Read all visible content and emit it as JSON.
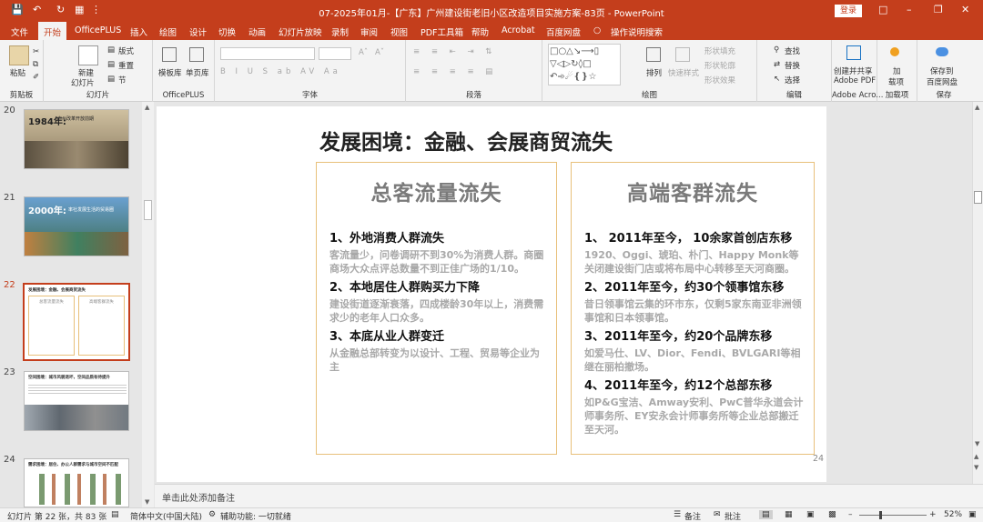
{
  "titlebar": {
    "title": "07-2025年01月-【广东】广州建设街老旧小区改造项目实施方案-83页  -  PowerPoint",
    "login": "登录"
  },
  "menu": {
    "tabs": [
      "文件",
      "开始",
      "OfficePLUS",
      "插入",
      "绘图",
      "设计",
      "切换",
      "动画",
      "幻灯片放映",
      "录制",
      "审阅",
      "视图",
      "PDF工具箱",
      "帮助",
      "Acrobat",
      "百度网盘"
    ],
    "active": "开始",
    "search": "操作说明搜索",
    "share": "共享"
  },
  "ribbon": {
    "clipboard": {
      "paste": "粘贴",
      "label": "剪贴板"
    },
    "slides": {
      "new_slide": "新建",
      "new_slide2": "幻灯片",
      "layout": "版式",
      "reset": "重置",
      "section": "节",
      "label": "幻灯片"
    },
    "officeplus": {
      "templates": "模板库",
      "single": "单页库",
      "label": "OfficePLUS"
    },
    "font": {
      "label": "字体"
    },
    "paragraph": {
      "label": "段落"
    },
    "drawing": {
      "arrange": "排列",
      "quick_style": "快速样式",
      "fill": "形状填充",
      "outline": "形状轮廓",
      "effect": "形状效果",
      "label": "绘图"
    },
    "editing": {
      "find": "查找",
      "replace": "替换",
      "select": "选择",
      "label": "编辑"
    },
    "adobe": {
      "create1": "创建并共享",
      "create2": "Adobe PDF",
      "label": "Adobe Acro..."
    },
    "addins": {
      "addin1": "加",
      "addin2": "载项",
      "label": "加载项"
    },
    "save": {
      "save1": "保存到",
      "save2": "百度网盘",
      "label": "保存"
    }
  },
  "thumbnails": [
    {
      "num": "20",
      "year": "1984年:",
      "caption": "广州改革开放前期"
    },
    {
      "num": "21",
      "year": "2000年:",
      "caption": "率社发展生活的贸易圈"
    },
    {
      "num": "22",
      "caption": "发展困境：金融、会展商贸流失",
      "left": "总客流量流失",
      "right": "高端客群流失"
    },
    {
      "num": "23",
      "caption": "空间困境：城市风貌退坏，空间品质有待提升"
    },
    {
      "num": "24",
      "caption": "需求困境：居住、办公人群需求与城市空间不匹配"
    }
  ],
  "slide": {
    "title": "发展困境：金融、会展商贸流失",
    "left": {
      "title": "总客流量流失",
      "items": [
        {
          "head": "1、外地消费人群流失",
          "body": "客流量少，问卷调研不到30%为消费人群。商圈商场大众点评总数量不到正佳广场的1/10。"
        },
        {
          "head": "2、本地居住人群购买力下降",
          "body": "建设街道逐渐衰落，四成楼龄30年以上，消费需求少的老年人口众多。"
        },
        {
          "head": "3、本底从业人群变迁",
          "body": "从金融总部转变为以设计、工程、贸易等企业为主"
        }
      ]
    },
    "right": {
      "title": "高端客群流失",
      "items": [
        {
          "head": "1、 2011年至今， 10余家首创店东移",
          "body": "1920、Oggi、琥珀、朴门、Happy Monk等关闭建设街门店或将布局中心转移至天河商圈。"
        },
        {
          "head": "2、2011年至今，约30个领事馆东移",
          "body": "昔日领事馆云集的环市东，仅剩5家东南亚非洲领事馆和日本领事馆。"
        },
        {
          "head": "3、2011年至今，约20个品牌东移",
          "body": "如爱马仕、LV、Dior、Fendi、BVLGARI等相继在丽柏撤场。"
        },
        {
          "head": "4、2011年至今，约12个总部东移",
          "body": "如P&G宝洁、Amway安利、PwC普华永道会计师事务所、EY安永会计师事务所等企业总部搬迁至天河。"
        }
      ]
    },
    "page_number": "24"
  },
  "notes": "单击此处添加备注",
  "status": {
    "slide_info": "幻灯片 第 22 张，共 83 张",
    "language": "简体中文(中国大陆)",
    "accessibility": "辅助功能: 一切就绪",
    "notes_btn": "备注",
    "comments_btn": "批注",
    "zoom": "52%"
  },
  "colors": {
    "accent": "#c43e1c",
    "panel_border": "#e8c07a"
  }
}
